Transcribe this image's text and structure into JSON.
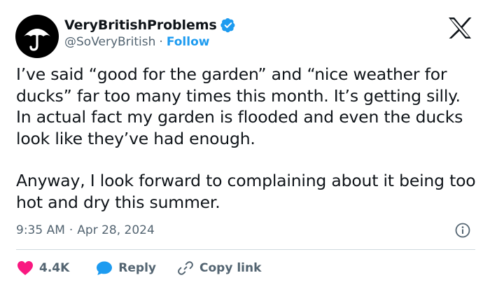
{
  "author": {
    "display_name": "VeryBritishProblems",
    "handle": "@SoVeryBritish",
    "separator": "·",
    "follow_label": "Follow"
  },
  "tweet": {
    "paragraphs": [
      "I’ve said “good for the garden” and “nice weather for ducks” far too many times this month. It’s getting silly. In actual fact my garden is flooded and even the ducks look like they’ve had enough.",
      "Anyway, I look forward to complaining about it being too hot and dry this summer."
    ],
    "time": "9:35 AM",
    "separator": "·",
    "date": "Apr 28, 2024"
  },
  "actions": {
    "likes": "4.4K",
    "reply_label": "Reply",
    "copy_link_label": "Copy link"
  },
  "icons": {
    "avatar": "umbrella-icon",
    "verified": "verified-badge-icon",
    "logo": "x-logo-icon",
    "info": "info-icon",
    "like": "heart-icon",
    "reply": "speech-bubble-icon",
    "copy_link": "link-icon"
  },
  "colors": {
    "text": "#0f1419",
    "secondary": "#536471",
    "accent": "#1d9bf0",
    "heart": "#f91880",
    "divider": "#cfd9de"
  }
}
